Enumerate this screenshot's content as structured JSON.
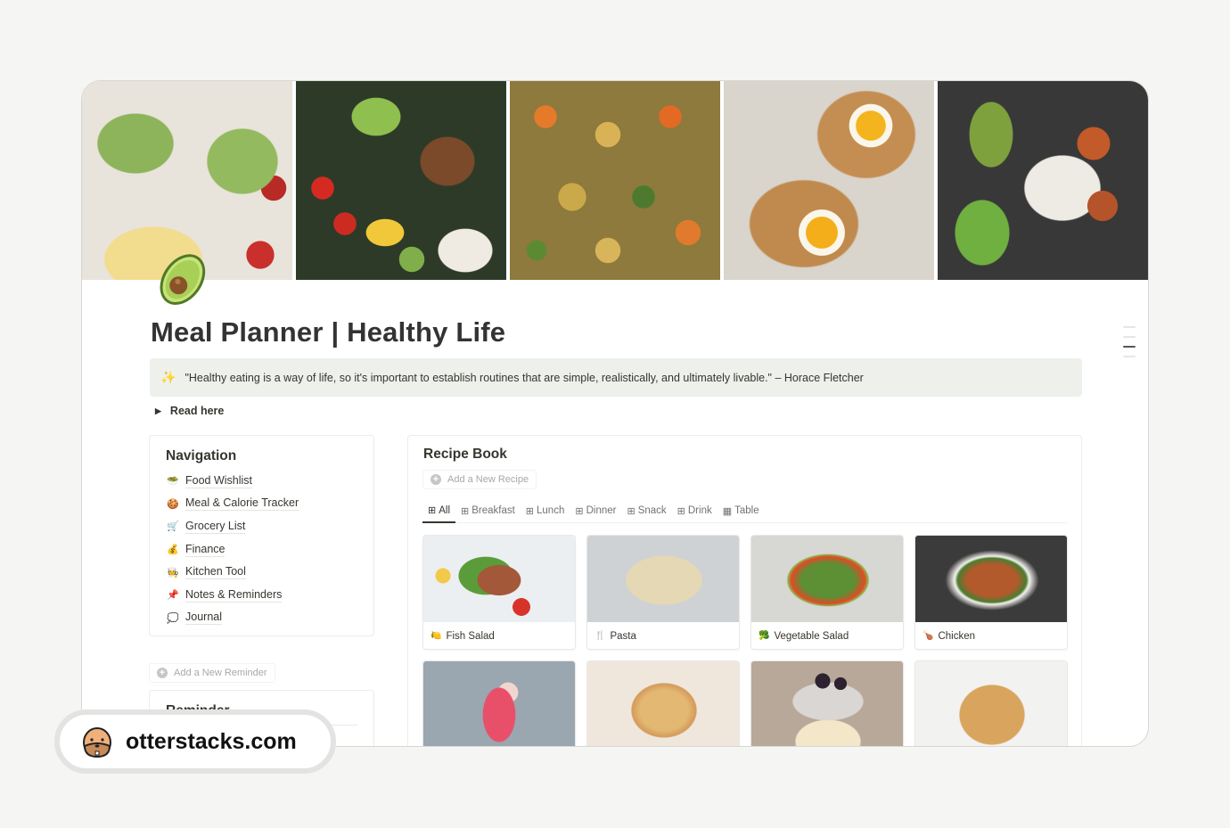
{
  "page": {
    "title": "Meal Planner | Healthy Life",
    "icon": "avocado-icon",
    "cover_images": [
      "avocado-toast-eggs",
      "salmon-rice-bowl",
      "roasted-vegetables",
      "egg-avocado-toast",
      "salmon-edamame-bowl"
    ]
  },
  "callout": {
    "icon": "sparkles-icon",
    "text": "\"Healthy eating is a way of life, so it's important to establish routines that are simple, realistically, and ultimately livable.\" – Horace Fletcher"
  },
  "toggle": {
    "label": "Read here"
  },
  "navigation": {
    "title": "Navigation",
    "items": [
      {
        "icon": "🥗",
        "label": "Food Wishlist"
      },
      {
        "icon": "🍪",
        "label": "Meal & Calorie Tracker"
      },
      {
        "icon": "🛒",
        "label": "Grocery List"
      },
      {
        "icon": "💰",
        "label": "Finance"
      },
      {
        "icon": "🧑‍🍳",
        "label": "Kitchen Tool"
      },
      {
        "icon": "📌",
        "label": "Notes & Reminders"
      },
      {
        "icon": "💭",
        "label": "Journal"
      }
    ]
  },
  "reminders": {
    "add_label": "Add a New Reminder",
    "title": "Reminder"
  },
  "recipe_book": {
    "title": "Recipe Book",
    "add_label": "Add a New Recipe",
    "tabs": [
      {
        "label": "All",
        "icon": "gallery-icon",
        "active": true
      },
      {
        "label": "Breakfast",
        "icon": "gallery-icon"
      },
      {
        "label": "Lunch",
        "icon": "gallery-icon"
      },
      {
        "label": "Dinner",
        "icon": "gallery-icon"
      },
      {
        "label": "Snack",
        "icon": "gallery-icon"
      },
      {
        "label": "Drink",
        "icon": "gallery-icon"
      },
      {
        "label": "Table",
        "icon": "table-icon"
      }
    ],
    "cards": [
      {
        "icon": "🍋",
        "label": "Fish Salad"
      },
      {
        "icon": "🍴",
        "label": "Pasta"
      },
      {
        "icon": "🥦",
        "label": "Vegetable Salad"
      },
      {
        "icon": "🍗",
        "label": "Chicken"
      },
      {
        "label": ""
      },
      {
        "label": ""
      },
      {
        "label": ""
      },
      {
        "label": ""
      }
    ]
  },
  "watermark": {
    "text": "otterstacks.com"
  }
}
